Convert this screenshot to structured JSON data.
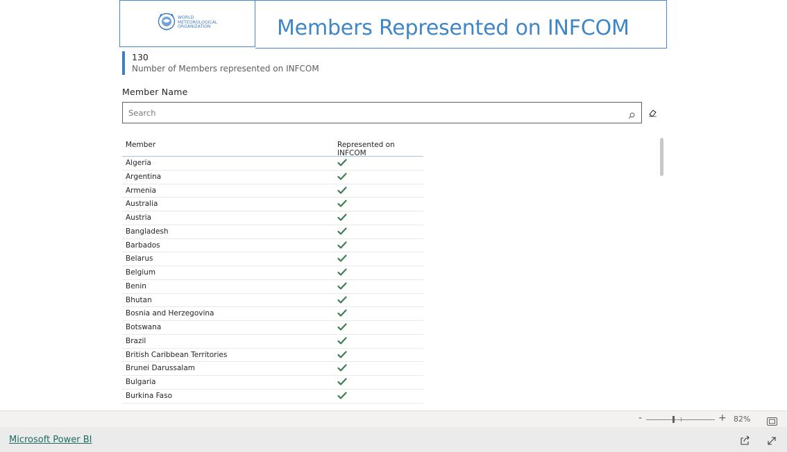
{
  "header": {
    "logo_text": "WORLD\nMETEOROLOGICAL\nORGANIZATION",
    "title": "Members Represented on INFCOM"
  },
  "kpi": {
    "value": "130",
    "label": "Number of Members represented on INFCOM"
  },
  "slicer": {
    "title": "Member Name",
    "search_placeholder": "Search"
  },
  "table": {
    "columns": [
      "Member",
      "Represented on INFCOM"
    ],
    "rows": [
      {
        "member": "Algeria",
        "represented": true
      },
      {
        "member": "Argentina",
        "represented": true
      },
      {
        "member": "Armenia",
        "represented": true
      },
      {
        "member": "Australia",
        "represented": true
      },
      {
        "member": "Austria",
        "represented": true
      },
      {
        "member": "Bangladesh",
        "represented": true
      },
      {
        "member": "Barbados",
        "represented": true
      },
      {
        "member": "Belarus",
        "represented": true
      },
      {
        "member": "Belgium",
        "represented": true
      },
      {
        "member": "Benin",
        "represented": true
      },
      {
        "member": "Bhutan",
        "represented": true
      },
      {
        "member": "Bosnia and Herzegovina",
        "represented": true
      },
      {
        "member": "Botswana",
        "represented": true
      },
      {
        "member": "Brazil",
        "represented": true
      },
      {
        "member": "British Caribbean Territories",
        "represented": true
      },
      {
        "member": "Brunei Darussalam",
        "represented": true
      },
      {
        "member": "Bulgaria",
        "represented": true
      },
      {
        "member": "Burkina Faso",
        "represented": true
      }
    ]
  },
  "zoom": {
    "minus": "-",
    "plus": "+",
    "percent": "82%",
    "level": 0.82
  },
  "footer": {
    "link": "Microsoft Power BI"
  },
  "colors": {
    "accent": "#3f86c8",
    "check": "#3a7d4f",
    "link": "#1d6b5e"
  },
  "icons": {
    "logo": "wmo-logo-icon",
    "search": "search-icon",
    "clear": "eraser-icon",
    "check": "checkmark-icon",
    "fit": "fit-to-page-icon",
    "share": "share-icon",
    "expand": "expand-icon"
  }
}
